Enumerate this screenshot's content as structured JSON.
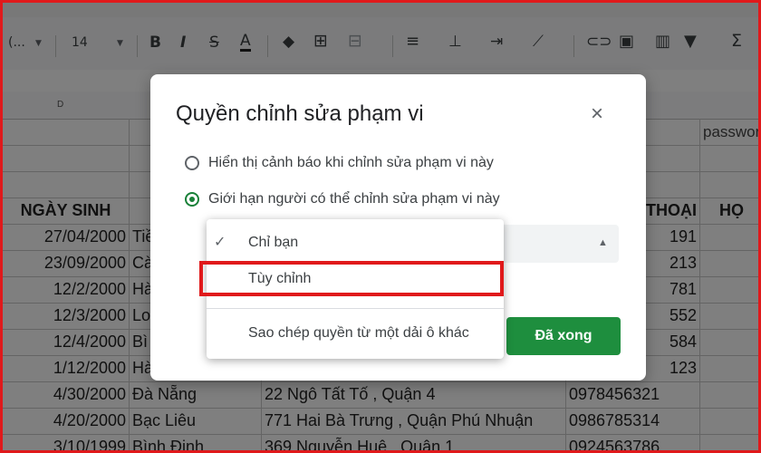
{
  "toolbar": {
    "font_name": "(...",
    "font_size": "14",
    "bold": "B",
    "italic": "I",
    "strike": "S",
    "text_color": "A",
    "sigma": "Σ"
  },
  "columns": {
    "d": "D"
  },
  "sheet": {
    "cell_password": "password",
    "header": [
      "NGÀY SINH",
      "",
      "",
      "THOẠI",
      "HỌ"
    ],
    "rows": [
      [
        "27/04/2000",
        "Tiề",
        "",
        "191",
        ""
      ],
      [
        "23/09/2000",
        "Cà",
        "",
        "213",
        ""
      ],
      [
        "12/2/2000",
        "Hà",
        "",
        "781",
        ""
      ],
      [
        "12/3/2000",
        "Lo",
        "",
        "552",
        ""
      ],
      [
        "12/4/2000",
        "Bì",
        "",
        "584",
        ""
      ],
      [
        "1/12/2000",
        "Hà",
        "",
        "123",
        ""
      ],
      [
        "4/30/2000",
        "Đà Nẵng",
        "22 Ngô Tất Tố , Quận 4",
        "0978456321",
        ""
      ],
      [
        "4/20/2000",
        "Bạc Liêu",
        "771 Hai Bà Trưng , Quận Phú Nhuận",
        "0986785314",
        ""
      ],
      [
        "3/10/1999",
        "Bình Định",
        "369 Nguyễn Huệ , Quận 1",
        "0924563786",
        ""
      ]
    ]
  },
  "dialog": {
    "title": "Quyền chỉnh sửa phạm vi",
    "close": "×",
    "option_warning": "Hiển thị cảnh báo khi chỉnh sửa phạm vi này",
    "option_restrict": "Giới hạn người có thể chỉnh sửa phạm vi này",
    "selected_option": "restrict",
    "done_label": "Đã xong"
  },
  "menu": {
    "items": [
      {
        "label": "Chỉ bạn",
        "checked": true
      },
      {
        "label": "Tùy chỉnh",
        "checked": false
      },
      {
        "label": "Sao chép quyền từ một dải ô khác",
        "checked": false
      }
    ]
  },
  "colors": {
    "highlight_border": "#e0191b",
    "accent_green": "#1e8e3e"
  }
}
